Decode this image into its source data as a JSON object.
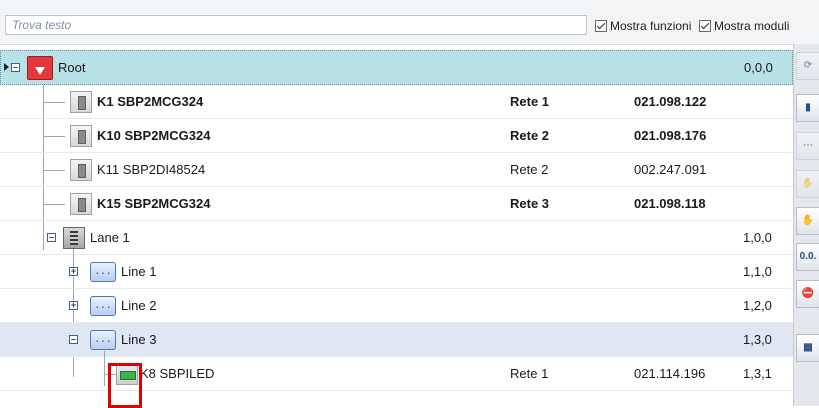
{
  "search": {
    "placeholder": "Trova testo"
  },
  "options": {
    "show_functions": "Mostra funzioni",
    "show_modules": "Mostra moduli"
  },
  "tree": {
    "root": {
      "name": "Root",
      "address": "0,0,0"
    },
    "modules": [
      {
        "name": "K1 SBP2MCG324",
        "network": "Rete 1",
        "serial": "021.098.122",
        "bold": true
      },
      {
        "name": "K10 SBP2MCG324",
        "network": "Rete 2",
        "serial": "021.098.176",
        "bold": true
      },
      {
        "name": "K11 SBP2DI48524",
        "network": "Rete 2",
        "serial": "002.247.091",
        "bold": false
      },
      {
        "name": "K15 SBP2MCG324",
        "network": "Rete 3",
        "serial": "021.098.118",
        "bold": true
      }
    ],
    "lane": {
      "name": "Lane 1",
      "address": "1,0,0"
    },
    "lines": [
      {
        "name": "Line 1",
        "address": "1,1,0"
      },
      {
        "name": "Line 2",
        "address": "1,2,0"
      },
      {
        "name": "Line 3",
        "address": "1,3,0"
      }
    ],
    "child": {
      "name": "K8 SBPILED",
      "network": "Rete 1",
      "serial": "021.114.196",
      "address": "1,3,1"
    }
  },
  "toolbar": {
    "buttons": [
      {
        "icon": "tree-refresh-icon",
        "label": ""
      },
      {
        "icon": "module-icon",
        "label": ""
      },
      {
        "icon": "network-icon",
        "label": ""
      },
      {
        "icon": "hand-icon",
        "label": ""
      },
      {
        "icon": "hand-red-icon",
        "label": ""
      },
      {
        "icon": "address-icon",
        "label": "0.0."
      },
      {
        "icon": "stop-icon",
        "label": ""
      },
      {
        "icon": "grid-icon",
        "label": ""
      }
    ]
  },
  "colors": {
    "root_row": "#b9e2e8",
    "selected_row": "#dfe7f2",
    "highlight": "#e00000",
    "search_placeholder": "#7d8ea5"
  }
}
